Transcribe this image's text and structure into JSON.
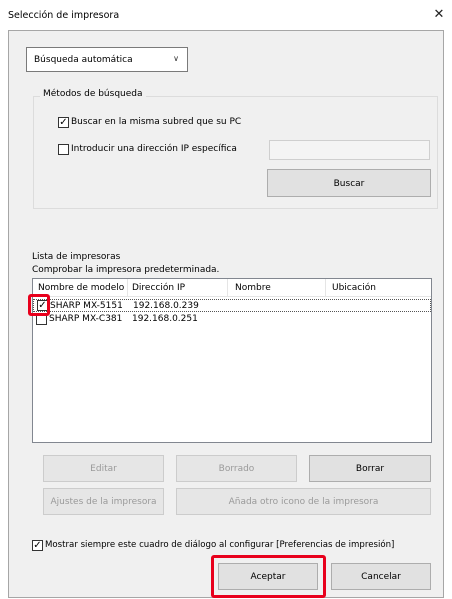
{
  "window": {
    "title": "Selección de impresora"
  },
  "search": {
    "mode_value": "Búsqueda automática",
    "group_label": "Métodos de búsqueda",
    "same_subnet_label": "Buscar en la misma subred que su PC",
    "same_subnet_checked": true,
    "specific_ip_label": "Introducir una dirección IP específica",
    "specific_ip_checked": false,
    "ip_value": "",
    "search_button": "Buscar"
  },
  "printer_list": {
    "title": "Lista de impresoras",
    "subtitle": "Comprobar la impresora predeterminada.",
    "columns": [
      "Nombre de modelo",
      "Dirección IP",
      "Nombre",
      "Ubicación"
    ],
    "rows": [
      {
        "model": "SHARP MX-5151",
        "ip": "192.168.0.239",
        "name": "",
        "location": "",
        "checked": true
      },
      {
        "model": "SHARP MX-C381",
        "ip": "192.168.0.251",
        "name": "",
        "location": "",
        "checked": false
      }
    ]
  },
  "actions": {
    "edit": "Editar",
    "delete_disabled": "Borrado",
    "delete": "Borrar",
    "printer_settings": "Ajustes de la impresora",
    "add_icon": "Añada otro icono de la impresora"
  },
  "footer": {
    "always_show_label": "Mostrar siempre este cuadro de diálogo al configurar [Preferencias de impresión]",
    "always_show_checked": true,
    "accept": "Aceptar",
    "cancel": "Cancelar"
  },
  "colors": {
    "highlight": "#e8001c",
    "dialog_bg": "#f0f0f0",
    "button_bg": "#e1e1e1"
  }
}
